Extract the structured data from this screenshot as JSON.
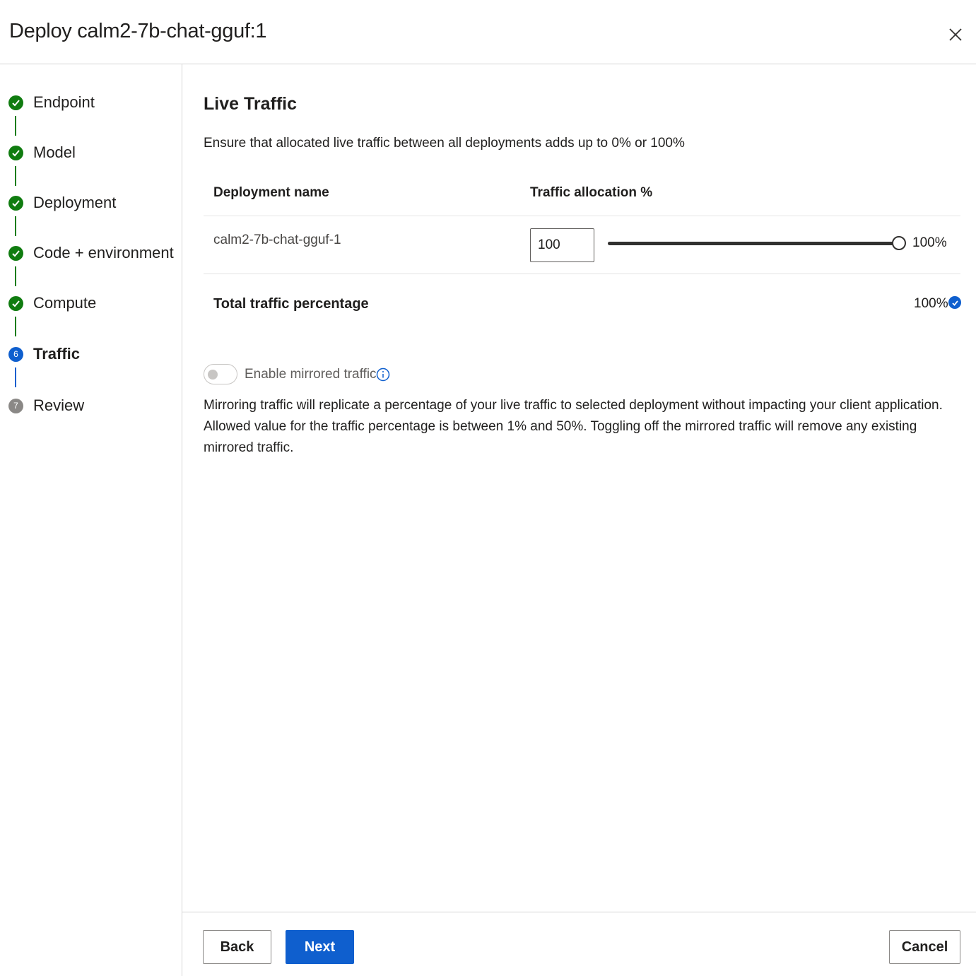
{
  "header": {
    "title": "Deploy calm2-7b-chat-gguf:1"
  },
  "steps": [
    {
      "label": "Endpoint",
      "status": "done"
    },
    {
      "label": "Model",
      "status": "done"
    },
    {
      "label": "Deployment",
      "status": "done"
    },
    {
      "label": "Code + environment",
      "status": "done"
    },
    {
      "label": "Compute",
      "status": "done"
    },
    {
      "label": "Traffic",
      "status": "current",
      "number": "6"
    },
    {
      "label": "Review",
      "status": "pending",
      "number": "7"
    }
  ],
  "main": {
    "section_title": "Live Traffic",
    "description": "Ensure that allocated live traffic between all deployments adds up to 0% or 100%",
    "table": {
      "col_name": "Deployment name",
      "col_alloc": "Traffic allocation %",
      "rows": [
        {
          "name": "calm2-7b-chat-gguf-1",
          "allocation_input": "100",
          "slider_value": 100,
          "slider_label": "100%"
        }
      ]
    },
    "total": {
      "label": "Total traffic percentage",
      "value": "100%"
    },
    "mirror": {
      "toggle_label": "Enable mirrored traffic",
      "enabled": false,
      "description": "Mirroring traffic will replicate a percentage of your live traffic to selected deployment without impacting your client application. Allowed value for the traffic percentage is between 1% and 50%. Toggling off the mirrored traffic will remove any existing mirrored traffic."
    }
  },
  "footer": {
    "back_label": "Back",
    "next_label": "Next",
    "cancel_label": "Cancel"
  },
  "colors": {
    "done": "#107c10",
    "accent": "#0f5fce",
    "pending": "#8a8886"
  },
  "icons": {
    "close": "close-icon",
    "check": "checkmark-icon",
    "info": "info-icon"
  }
}
